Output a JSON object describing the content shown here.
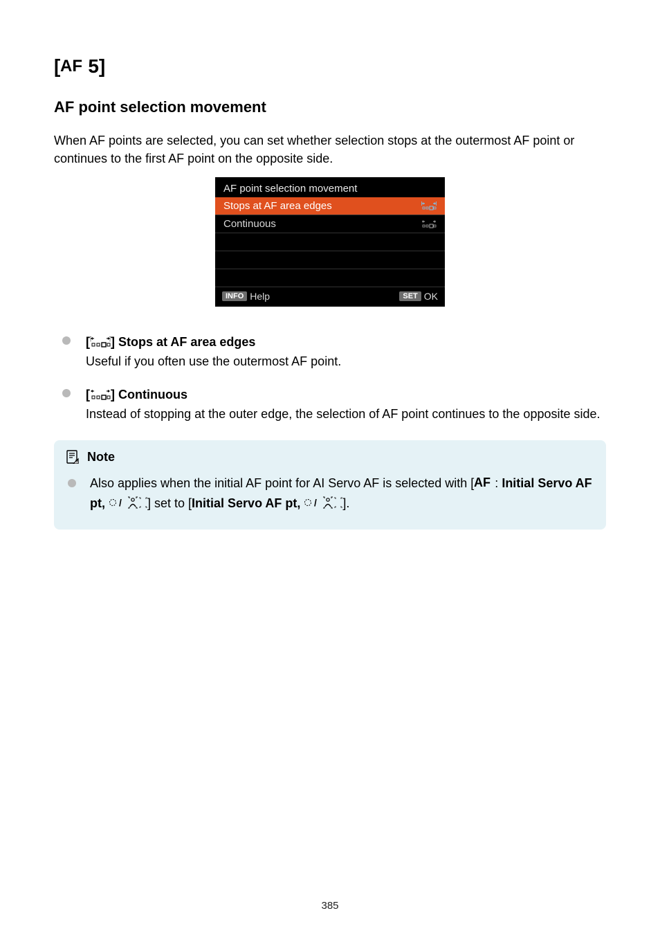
{
  "header": {
    "tab_label": "5"
  },
  "section": {
    "title": "AF point selection movement",
    "intro": "When AF points are selected, you can set whether selection stops at the outermost AF point or continues to the first AF point on the opposite side."
  },
  "screenshot": {
    "title": "AF point selection movement",
    "rows": [
      {
        "label": "Stops at AF area edges",
        "selected": true,
        "icon": "stops"
      },
      {
        "label": "Continuous",
        "selected": false,
        "icon": "continuous"
      },
      {
        "label": "",
        "selected": false,
        "icon": ""
      },
      {
        "label": "",
        "selected": false,
        "icon": ""
      },
      {
        "label": "",
        "selected": false,
        "icon": ""
      }
    ],
    "footer": {
      "left_badge": "INFO",
      "left_text": "Help",
      "right_badge": "SET",
      "right_text": "OK"
    }
  },
  "options": [
    {
      "icon": "stops",
      "title": "Stops at AF area edges",
      "desc": "Useful if you often use the outermost AF point."
    },
    {
      "icon": "continuous",
      "title": "Continuous",
      "desc": "Instead of stopping at the outer edge, the selection of AF point continues to the opposite side."
    }
  ],
  "note": {
    "label": "Note",
    "parts": {
      "p1": "Also applies when the initial AF point for AI Servo AF is selected with [",
      "p2": ": ",
      "p3": "Initial Servo AF pt, ",
      "p4": "] set to [",
      "p5": "Initial Servo AF pt, ",
      "p6": "]."
    }
  },
  "page_number": "385"
}
